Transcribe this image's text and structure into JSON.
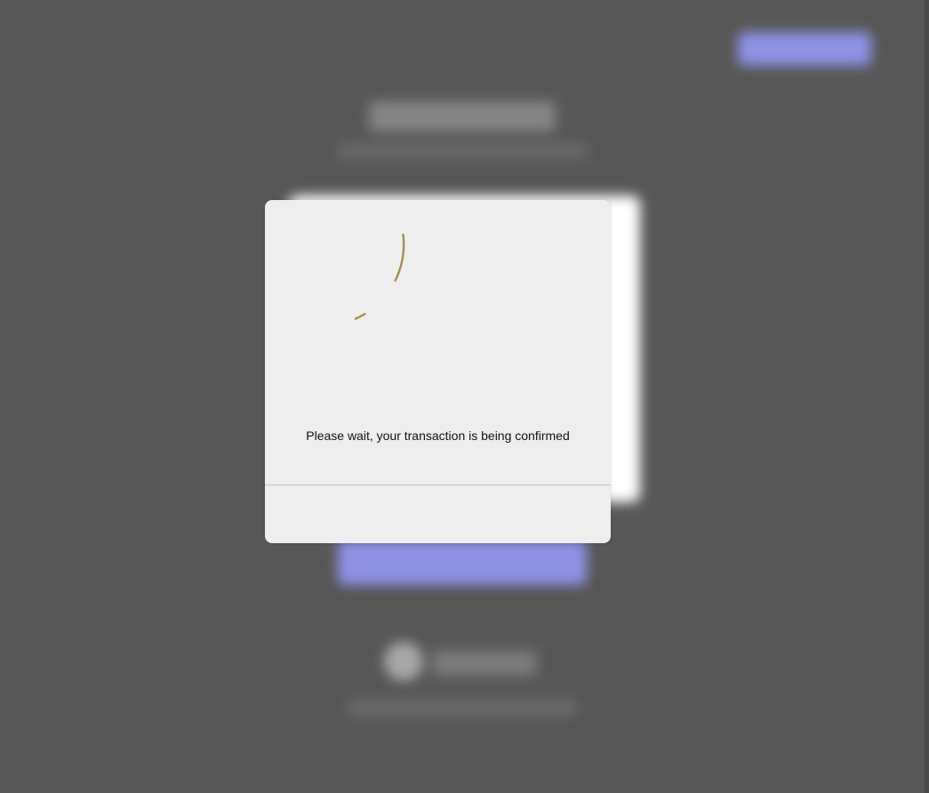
{
  "loading_dialog": {
    "message": "Please wait, your transaction is being confirmed",
    "spinner_icon": "loading-spinner-icon",
    "spinner_color": "#a38f4f"
  },
  "colors": {
    "overlay_background": "#575757",
    "dialog_background": "#eeeeee",
    "background_button_accent": "#8e92e6"
  }
}
